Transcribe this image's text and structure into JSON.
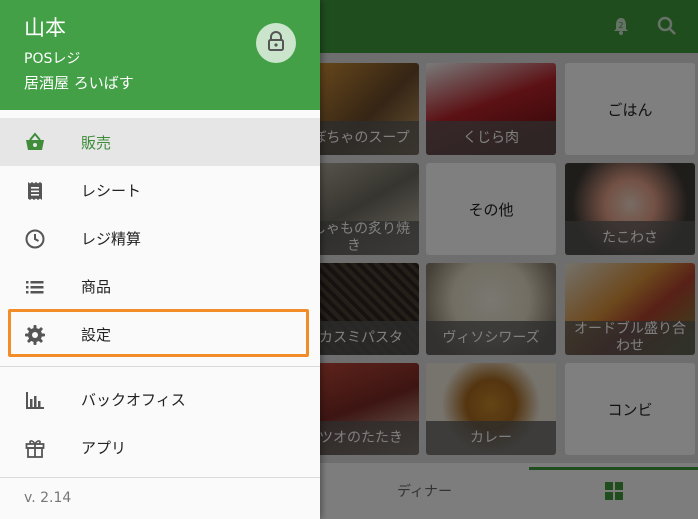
{
  "drawer": {
    "user_name": "山本",
    "app_name": "POSレジ",
    "store_name": "居酒屋 ろいばす",
    "menu": [
      {
        "label": "販売",
        "icon": "basket-icon",
        "selected": true
      },
      {
        "label": "レシート",
        "icon": "receipt-icon"
      },
      {
        "label": "レジ精算",
        "icon": "clock-icon"
      },
      {
        "label": "商品",
        "icon": "list-icon"
      },
      {
        "label": "設定",
        "icon": "gear-icon"
      },
      {
        "label": "バックオフィス",
        "icon": "bar-chart-icon"
      },
      {
        "label": "アプリ",
        "icon": "gift-icon"
      }
    ],
    "version": "v. 2.14"
  },
  "products": [
    {
      "label": "かぼちゃのスープ"
    },
    {
      "label": "くじら肉"
    },
    {
      "label": "ごはん"
    },
    {
      "label": "ししゃもの炙り焼き"
    },
    {
      "label": "その他"
    },
    {
      "label": "たこわさ"
    },
    {
      "label": "イカスミパスタ"
    },
    {
      "label": "ヴィソシワーズ"
    },
    {
      "label": "オードブル盛り合わせ"
    },
    {
      "label": "カツオのたたき"
    },
    {
      "label": "カレー"
    },
    {
      "label": "コンビ"
    }
  ],
  "bottom_tabs": [
    {
      "label": "ディナー"
    }
  ],
  "colors": {
    "brand_green": "#43a047",
    "highlight_orange": "#f28c28"
  }
}
